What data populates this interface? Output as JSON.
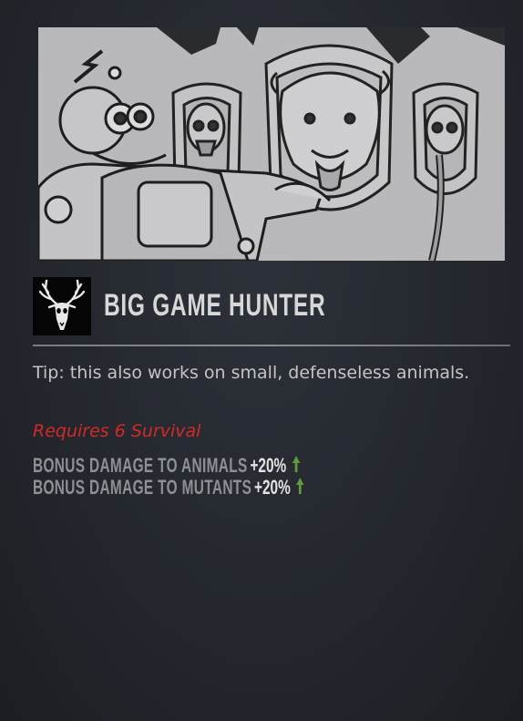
{
  "perk": {
    "title": "BIG GAME HUNTER",
    "icon": "deer-skull-icon",
    "tip": "Tip: this also works on small, defenseless animals.",
    "requirement": "Requires 6 Survival",
    "bonuses": [
      {
        "label": "BONUS DAMAGE TO ANIMALS",
        "value": "+20%"
      },
      {
        "label": "BONUS DAMAGE TO MUTANTS",
        "value": "+20%"
      }
    ]
  },
  "colors": {
    "requirement": "#d42a24",
    "increase_arrow": "#5f9a3e",
    "illustration_bg": "#b9b9bb"
  }
}
